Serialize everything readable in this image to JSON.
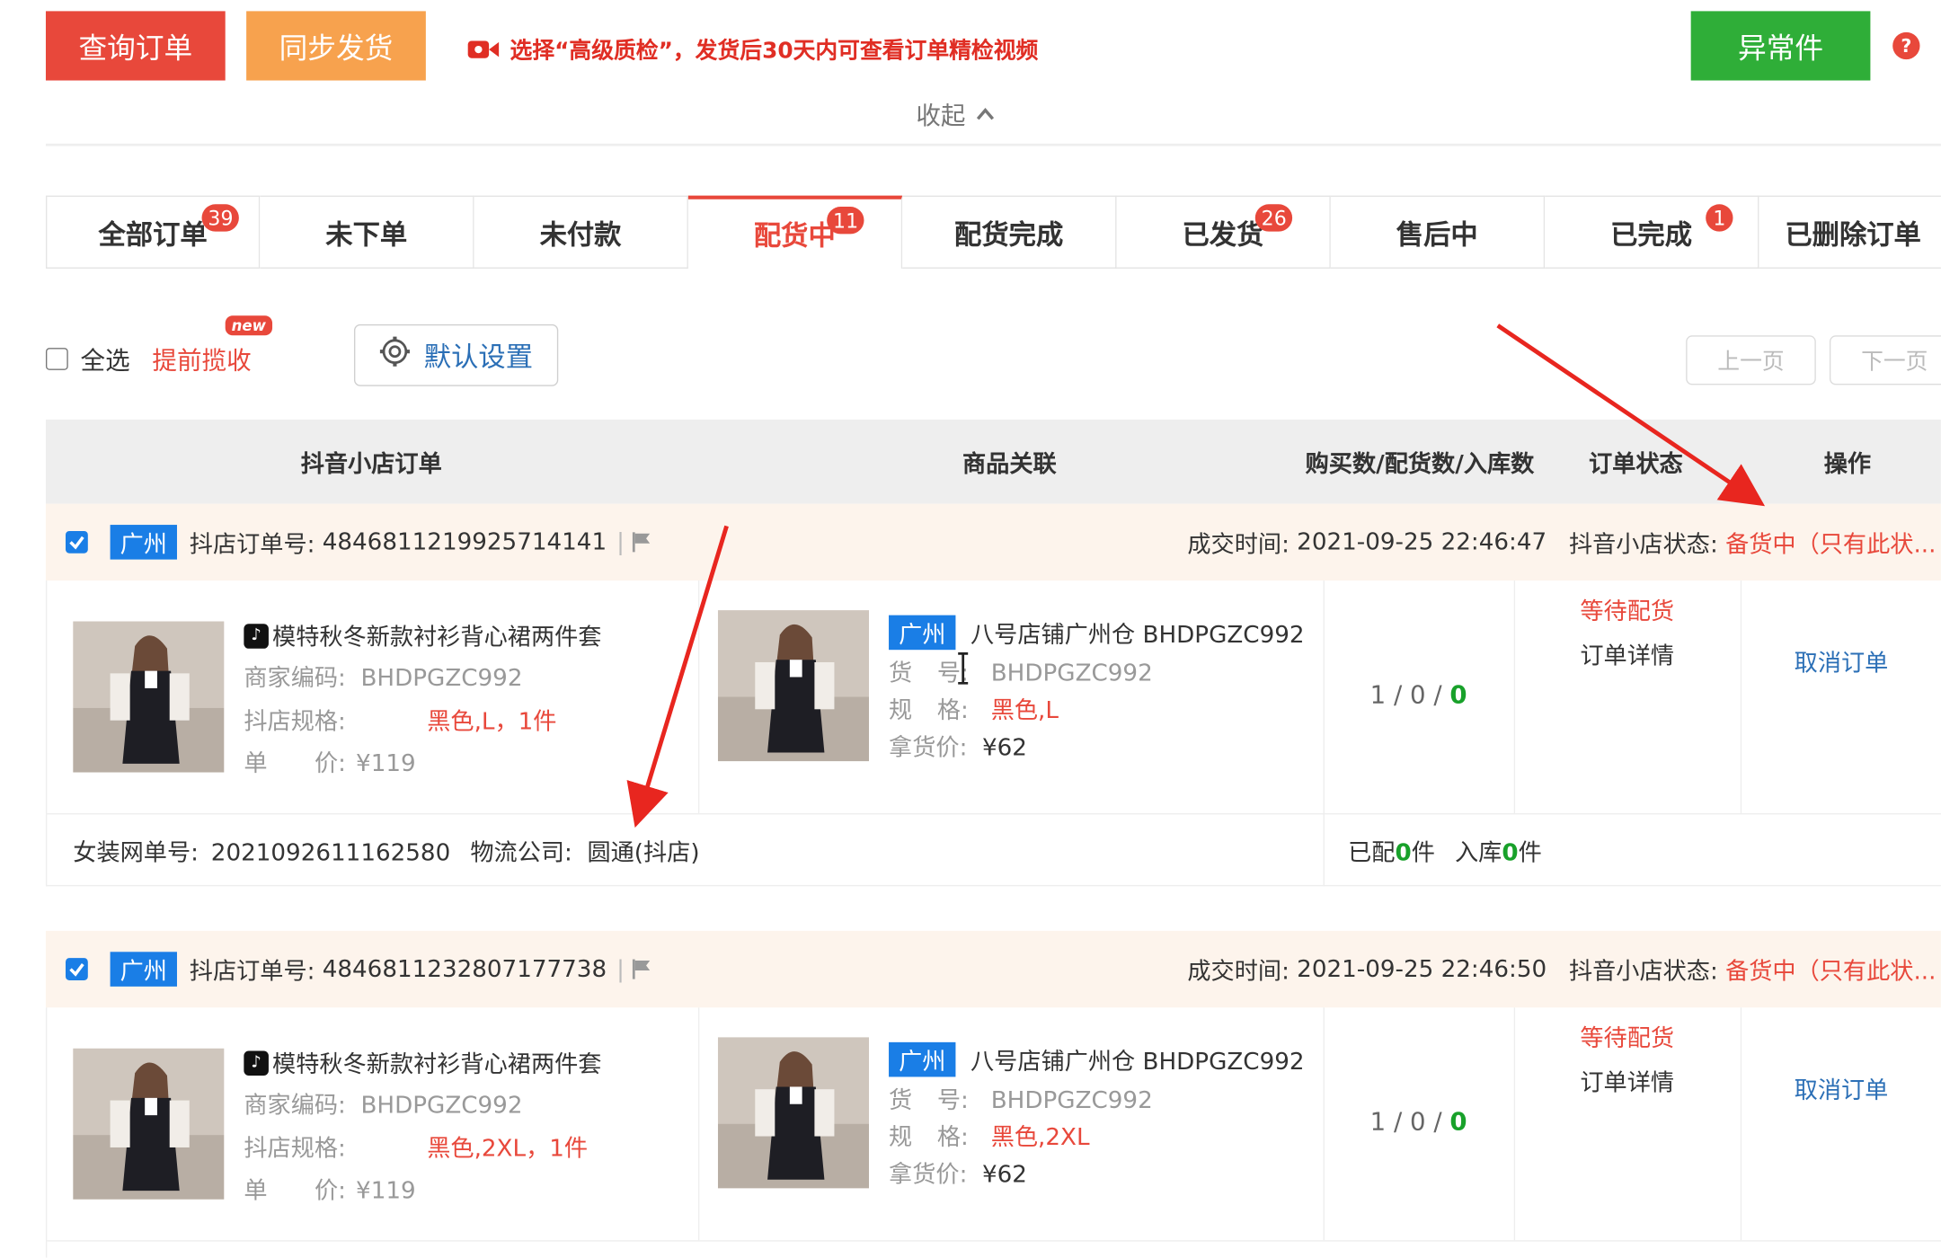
{
  "toolbar": {
    "query_label": "查询订单",
    "sync_label": "同步发货",
    "notice": "选择“高级质检”，发货后30天内可查看订单精检视频",
    "abnormal_label": "异常件",
    "help": "?",
    "collapse_label": "收起"
  },
  "tabs": [
    {
      "label": "全部订单",
      "badge": "39"
    },
    {
      "label": "未下单",
      "badge": ""
    },
    {
      "label": "未付款",
      "badge": ""
    },
    {
      "label": "配货中",
      "badge": "11"
    },
    {
      "label": "配货完成",
      "badge": ""
    },
    {
      "label": "已发货",
      "badge": "26"
    },
    {
      "label": "售后中",
      "badge": ""
    },
    {
      "label": "已完成",
      "badge": "1"
    },
    {
      "label": "已删除订单",
      "badge": ""
    }
  ],
  "active_tab": "配货中",
  "actions": {
    "select_all": "全选",
    "early_collect": "提前揽收",
    "new_badge": "new",
    "default_settings": "默认设置",
    "prev_page": "上一页",
    "next_page": "下一页"
  },
  "table_headers": [
    "抖音小店订单",
    "商品关联",
    "购买数/配货数/入库数",
    "订单状态",
    "操作"
  ],
  "orders": [
    {
      "city": "广州",
      "order_no_label": "抖店订单号:",
      "order_no": "4846811219925714141",
      "deal_time_label": "成交时间:",
      "deal_time": "2021-09-25 22:46:47",
      "shop_status_label": "抖音小店状态:",
      "shop_status": "备货中（只有此状...",
      "product_title": "模特秋冬新款衬衫背心裙两件套",
      "merchant_code_label": "商家编码:",
      "merchant_code": "BHDPGZC992",
      "spec_label": "抖店规格:",
      "spec": "黑色,L，1件",
      "price_label_a": "单",
      "price_label_b": "价:",
      "price": "¥119",
      "linked_city": "广州",
      "linked_store": "八号店铺广州仓 BHDPGZC992",
      "goods_no_label_a": "货",
      "goods_no_label_b": "号:",
      "goods_no": "BHDPGZC992",
      "spec2_label_a": "规",
      "spec2_label_b": "格:",
      "spec2": "黑色,L",
      "pickup_price_label": "拿货价:",
      "pickup_price": "¥62",
      "qty_a": "1",
      "qty_b": "0",
      "qty_c": "0",
      "status": "等待配货",
      "detail_link": "订单详情",
      "cancel_link": "取消订单",
      "footer_no_label": "女装网单号:",
      "footer_no": "2021092611162580",
      "footer_logistics_label": "物流公司:",
      "footer_logistics": "圆通(抖店)",
      "alloc_label": "已配",
      "alloc_count": "0",
      "alloc_unit": "件",
      "stock_label": "入库",
      "stock_count": "0",
      "stock_unit": "件"
    },
    {
      "city": "广州",
      "order_no_label": "抖店订单号:",
      "order_no": "4846811232807177738",
      "deal_time_label": "成交时间:",
      "deal_time": "2021-09-25 22:46:50",
      "shop_status_label": "抖音小店状态:",
      "shop_status": "备货中（只有此状...",
      "product_title": "模特秋冬新款衬衫背心裙两件套",
      "merchant_code_label": "商家编码:",
      "merchant_code": "BHDPGZC992",
      "spec_label": "抖店规格:",
      "spec": "黑色,2XL，1件",
      "price_label_a": "单",
      "price_label_b": "价:",
      "price": "¥119",
      "linked_city": "广州",
      "linked_store": "八号店铺广州仓 BHDPGZC992",
      "goods_no_label_a": "货",
      "goods_no_label_b": "号:",
      "goods_no": "BHDPGZC992",
      "spec2_label_a": "规",
      "spec2_label_b": "格:",
      "spec2": "黑色,2XL",
      "pickup_price_label": "拿货价:",
      "pickup_price": "¥62",
      "qty_a": "1",
      "qty_b": "0",
      "qty_c": "0",
      "status": "等待配货",
      "detail_link": "订单详情",
      "cancel_link": "取消订单"
    }
  ],
  "colors": {
    "primary_red": "#e8483b",
    "orange": "#f7a24e",
    "green": "#2fae38",
    "blue": "#1a7ee6",
    "link_blue": "#2b6fb6"
  }
}
